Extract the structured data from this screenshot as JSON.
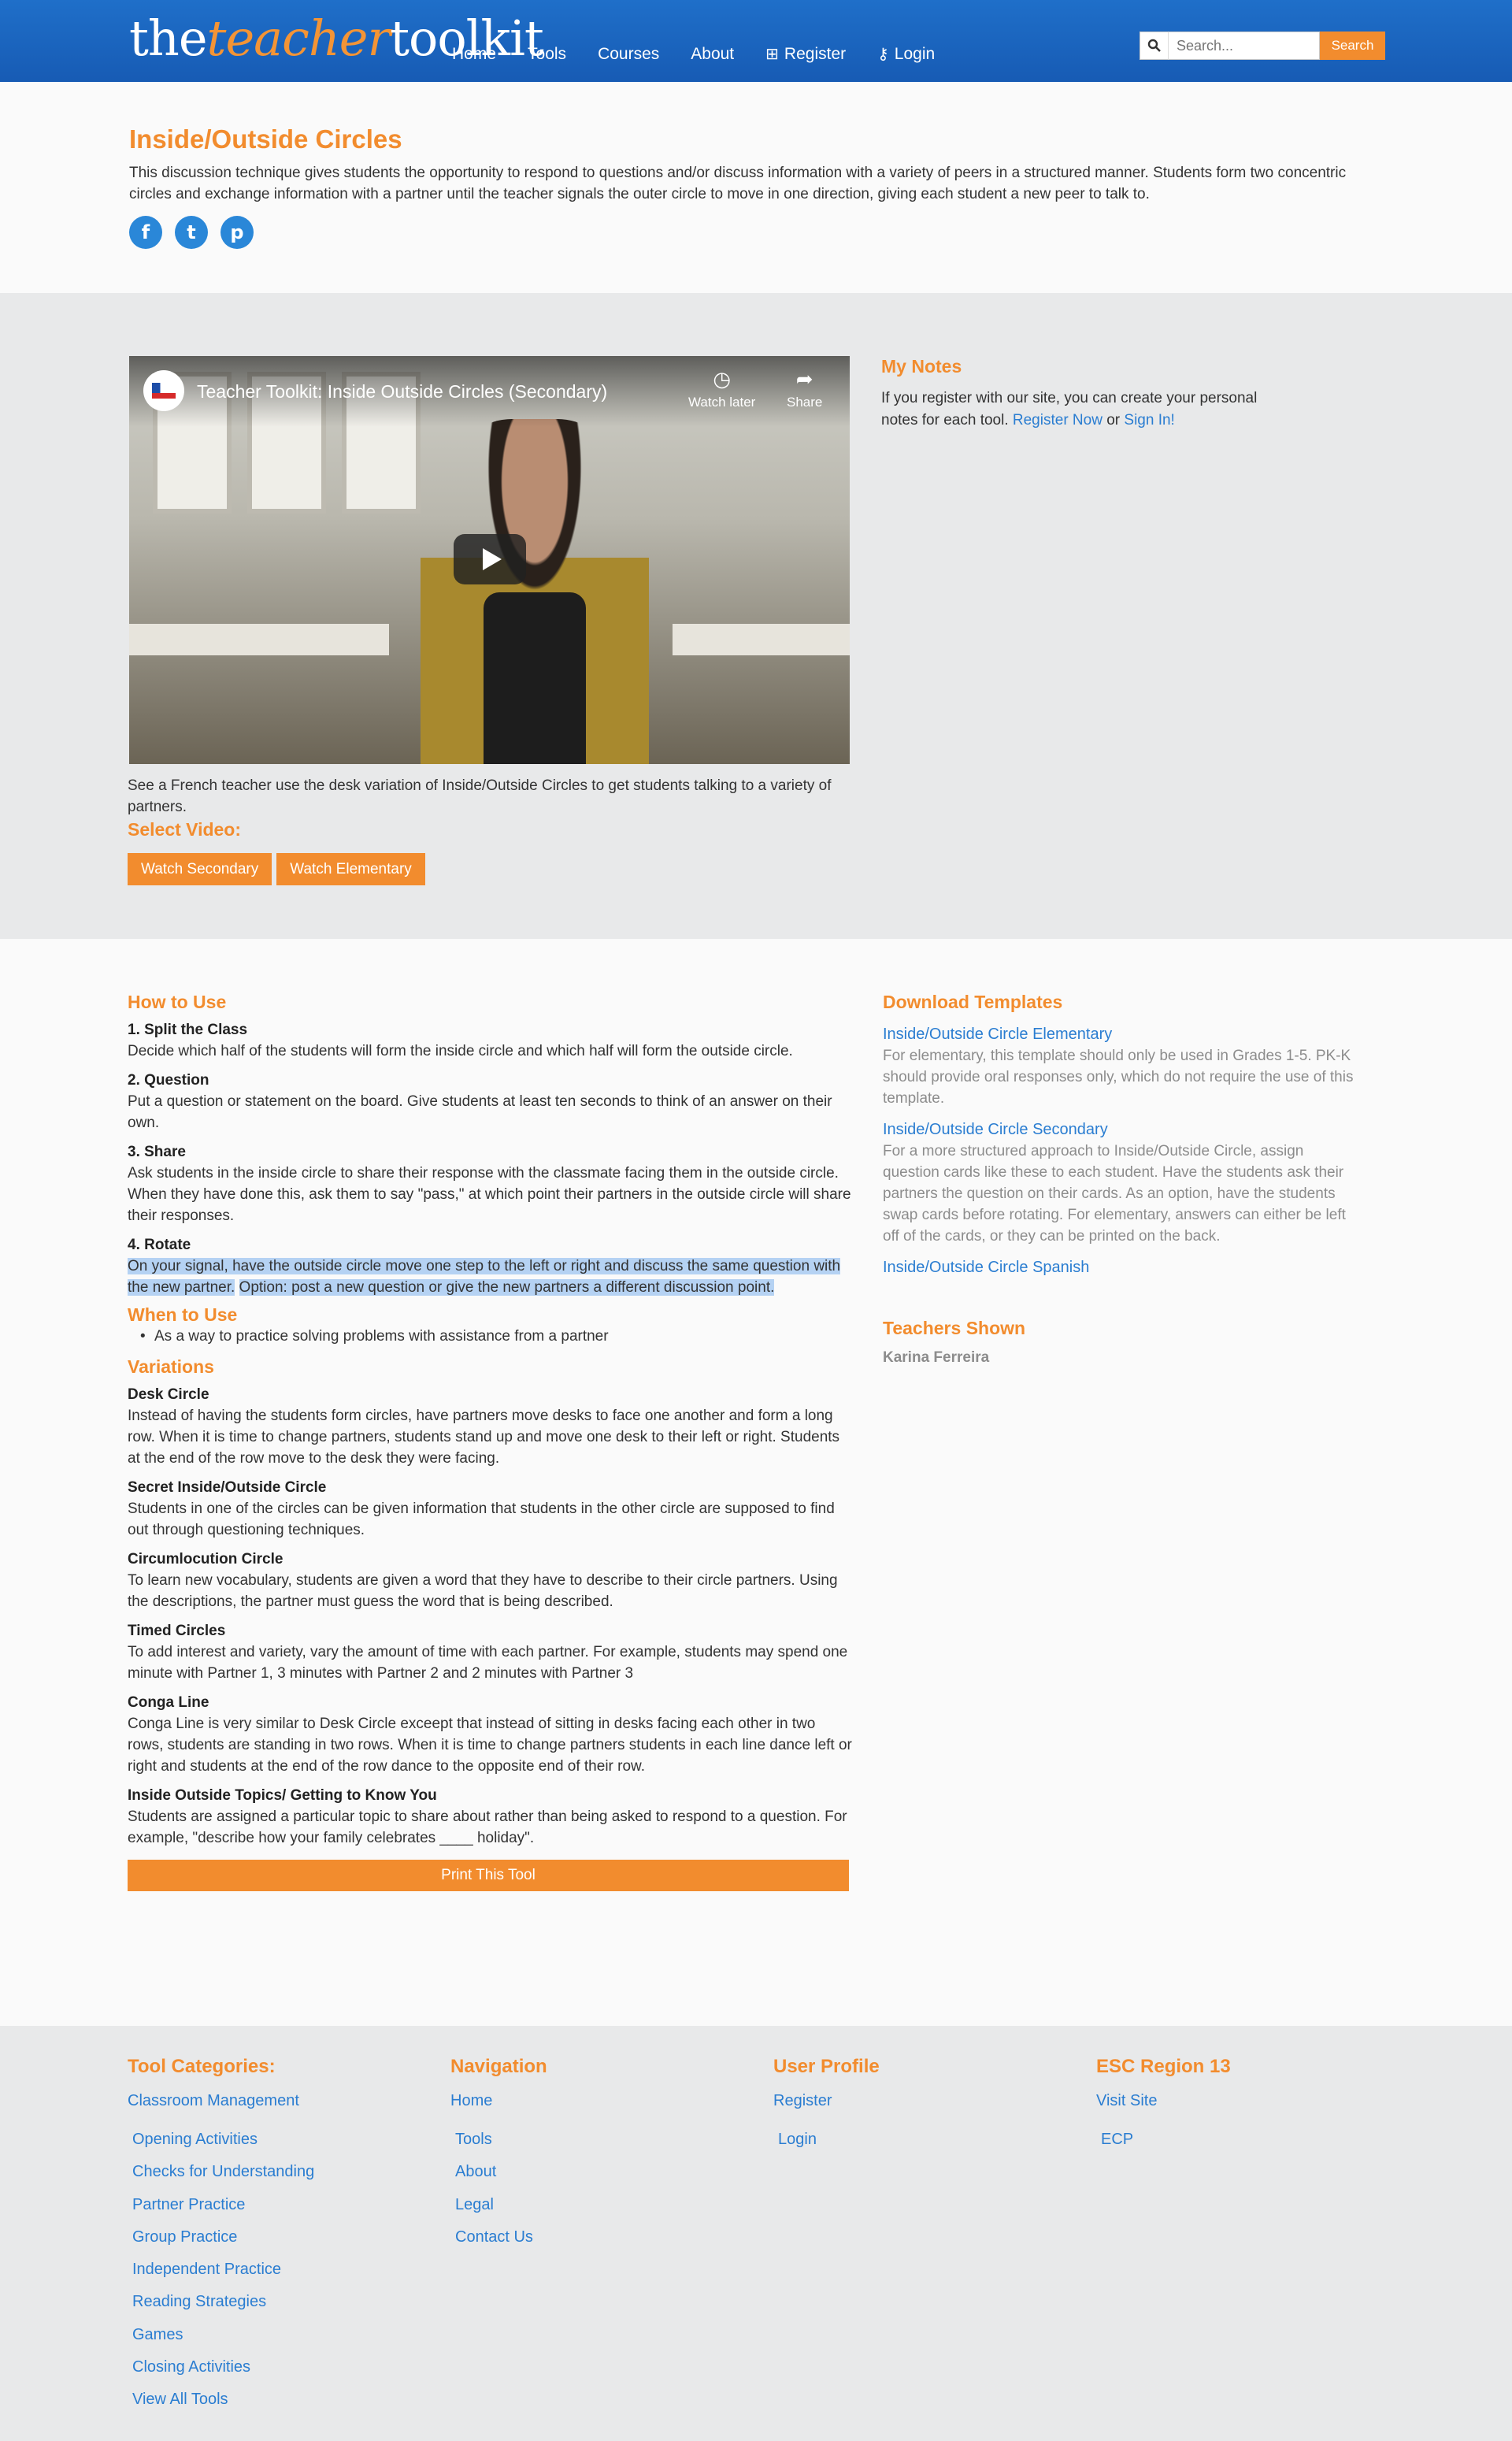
{
  "header": {
    "logo_the": "the",
    "logo_teacher": "teacher",
    "logo_toolkit": "toolkit",
    "nav": [
      "Home",
      "Tools",
      "Courses",
      "About",
      "Register",
      "Login"
    ],
    "search_placeholder": "Search...",
    "search_button": "Search"
  },
  "intro": {
    "title": "Inside/Outside Circles",
    "description": "This discussion technique gives students the opportunity to respond to questions and/or discuss information with a variety of peers in a structured manner. Students form two concentric circles and exchange information with a partner until the teacher signals the outer circle to move in one direction, giving each student a new peer to talk to.",
    "social": [
      "f",
      "t",
      "p"
    ]
  },
  "video": {
    "title": "Teacher Toolkit: Inside Outside Circles (Secondary)",
    "watch_later": "Watch later",
    "share": "Share",
    "caption": "See a French teacher use the desk variation of Inside/Outside Circles to get students talking to a variety of partners.",
    "select_label": "Select Video:",
    "buttons": [
      "Watch Secondary",
      "Watch Elementary"
    ]
  },
  "notes": {
    "title": "My Notes",
    "text": "If you register with our site, you can create your personal notes for each tool.",
    "register_link": "Register Now",
    "or": "or",
    "signin_link": "Sign In!"
  },
  "how_to_use": {
    "title": "How to Use",
    "steps": [
      {
        "title": "1. Split the Class",
        "text": "Decide which half of the students will form the inside circle and which half will form the outside circle."
      },
      {
        "title": "2. Question",
        "text": "Put a question or statement on the board.  Give students at least ten seconds to think of an answer on their own."
      },
      {
        "title": "3. Share",
        "text": "Ask students in the inside circle to share their response with the classmate facing them in the outside circle. When they have done this, ask them to say \"pass,\" at which point their partners in the outside circle will share their responses."
      },
      {
        "title": "4. Rotate",
        "text": "On your signal, have the outside circle move one step to the left or right and discuss the same question with the new partner.",
        "option": "Option: post a new question or give the new partners a different discussion point."
      }
    ]
  },
  "when_to_use": {
    "title": "When to Use",
    "items": [
      "As a way to practice solving problems with assistance from a partner"
    ]
  },
  "variations": {
    "title": "Variations",
    "items": [
      {
        "title": "Desk Circle",
        "text": "Instead of having the students form circles, have partners move desks to face one another and form a long row. When it is time to change partners, students stand up and move one desk to their left or right. Students at the end of the row move to the desk they were facing."
      },
      {
        "title": "Secret Inside/Outside Circle",
        "text": "Students in one of the circles can be given information that students in the other circle are supposed to find out through questioning techniques."
      },
      {
        "title": "Circumlocution Circle",
        "text": "To learn new vocabulary, students are given a word that they have to describe to their circle partners. Using the descriptions, the partner must guess the word that is being described."
      },
      {
        "title": "Timed Circles",
        "text": "To add interest and variety, vary the amount of time with each partner.  For example, students may spend one minute with Partner 1, 3 minutes with Partner 2 and 2 minutes with Partner 3"
      },
      {
        "title": "Conga Line",
        "text": "Conga Line is very similar to Desk Circle exceept that instead of sitting in desks facing each other in two rows, students are standing in two rows.  When it is time to change partners students in each line dance left or right and students at the end of the row dance to the opposite end of their row."
      },
      {
        "title": "Inside Outside Topics/ Getting to Know You",
        "text": "Students are assigned a particular topic to share about rather than being asked to respond to a question.  For example, \"describe how your family celebrates ____ holiday\"."
      }
    ],
    "print_button": "Print This Tool"
  },
  "templates": {
    "title": "Download Templates",
    "items": [
      {
        "link": "Inside/Outside Circle Elementary",
        "desc": "For elementary, this template should only be used in Grades 1-5. PK-K should provide oral responses only, which do not require the use of this template."
      },
      {
        "link": "Inside/Outside Circle Secondary",
        "desc": "For a more structured approach to Inside/Outside Circle, assign question cards like these to each student. Have the students ask their partners the question on their cards.  As an option, have the students swap cards before rotating. For elementary, answers can either be left off of the cards, or they can be printed on the back."
      },
      {
        "link": "Inside/Outside Circle Spanish",
        "desc": ""
      }
    ],
    "teachers_title": "Teachers Shown",
    "teachers": [
      "Karina Ferreira"
    ]
  },
  "footer": {
    "categories_title": "Tool Categories:",
    "categories_first": "Classroom Management",
    "categories": [
      "Opening Activities",
      "Checks for Understanding",
      "Partner Practice",
      "Group Practice",
      "Independent Practice",
      "Reading Strategies",
      "Games",
      "Closing Activities",
      "View All Tools"
    ],
    "navigation_title": "Navigation",
    "navigation_first": "Home",
    "navigation": [
      "Tools",
      "About",
      "Legal",
      "Contact Us"
    ],
    "profile_title": "User Profile",
    "profile_first": "Register",
    "profile": [
      "Login"
    ],
    "esc_title": "ESC Region 13",
    "esc_first": "Visit Site",
    "esc": [
      "ECP"
    ]
  },
  "colors": {
    "brand_blue": "#1f6fc9",
    "accent_orange": "#f28c2e",
    "link_blue": "#2a7dd1"
  }
}
